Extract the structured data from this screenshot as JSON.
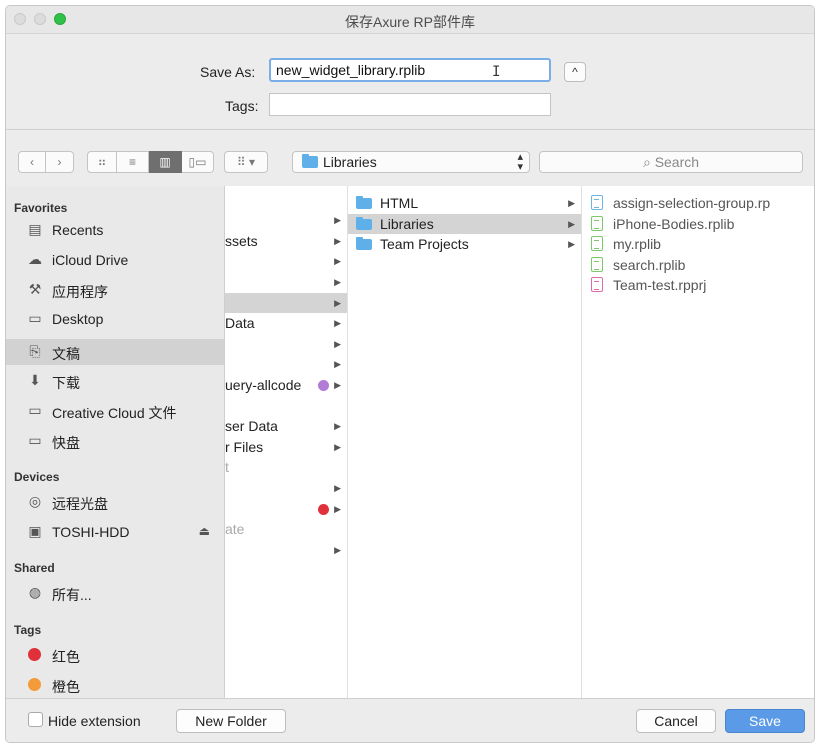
{
  "window": {
    "title": "保存Axure RP部件库"
  },
  "form": {
    "save_as_label": "Save As:",
    "save_as_value": "new_widget_library.rplib",
    "tags_label": "Tags:",
    "tags_value": ""
  },
  "toolbar": {
    "back_glyph": "‹",
    "forward_glyph": "›",
    "path_label": "Libraries",
    "search_placeholder": "Search"
  },
  "sidebar": {
    "favorites_header": "Favorites",
    "favorites": [
      {
        "label": "Recents",
        "icon": "recents-icon"
      },
      {
        "label": "iCloud Drive",
        "icon": "cloud-icon"
      },
      {
        "label": "应用程序",
        "icon": "applications-icon"
      },
      {
        "label": "Desktop",
        "icon": "desktop-icon"
      },
      {
        "label": "文稿",
        "icon": "documents-icon",
        "selected": true
      },
      {
        "label": "下载",
        "icon": "downloads-icon"
      },
      {
        "label": "Creative Cloud 文件",
        "icon": "folder-icon"
      },
      {
        "label": "快盘",
        "icon": "folder-icon"
      }
    ],
    "devices_header": "Devices",
    "devices": [
      {
        "label": "远程光盘",
        "icon": "disc-icon"
      },
      {
        "label": "TOSHI-HDD",
        "icon": "drive-icon"
      }
    ],
    "shared_header": "Shared",
    "shared": [
      {
        "label": "所有...",
        "icon": "network-icon"
      }
    ],
    "tags_header": "Tags",
    "tags": [
      {
        "label": "红色",
        "color": "#e0313a"
      },
      {
        "label": "橙色",
        "color": "#f29b38"
      }
    ]
  },
  "columns": {
    "col1": [
      {
        "text": "",
        "arrow": true
      },
      {
        "text": "ssets",
        "arrow": true
      },
      {
        "text": "",
        "arrow": true
      },
      {
        "text": "",
        "arrow": true
      },
      {
        "text": "",
        "arrow": true,
        "selected": true
      },
      {
        "text": "Data",
        "arrow": true
      },
      {
        "text": "",
        "arrow": true
      },
      {
        "text": "",
        "arrow": true
      },
      {
        "text": "uery-allcode",
        "arrow": true,
        "dot": "purple"
      },
      {
        "text": "",
        "arrow": false
      },
      {
        "text": "ser Data",
        "arrow": true
      },
      {
        "text": "r Files",
        "arrow": true
      },
      {
        "text": "t",
        "arrow": false
      },
      {
        "text": "",
        "arrow": true
      },
      {
        "text": "",
        "arrow": true,
        "dot": "red"
      },
      {
        "text": "ate",
        "arrow": false
      },
      {
        "text": "",
        "arrow": true
      }
    ],
    "col2": [
      {
        "text": "HTML",
        "selected": false
      },
      {
        "text": "Libraries",
        "selected": true
      },
      {
        "text": "Team Projects",
        "selected": false
      }
    ],
    "col3": [
      {
        "text": "assign-selection-group.rp",
        "type": "blue"
      },
      {
        "text": "iPhone-Bodies.rplib",
        "type": "green"
      },
      {
        "text": "my.rplib",
        "type": "green"
      },
      {
        "text": "search.rplib",
        "type": "green"
      },
      {
        "text": "Team-test.rpprj",
        "type": "pink"
      }
    ]
  },
  "bottom": {
    "hide_extension_label": "Hide extension",
    "new_folder_label": "New Folder",
    "cancel_label": "Cancel",
    "save_label": "Save"
  }
}
